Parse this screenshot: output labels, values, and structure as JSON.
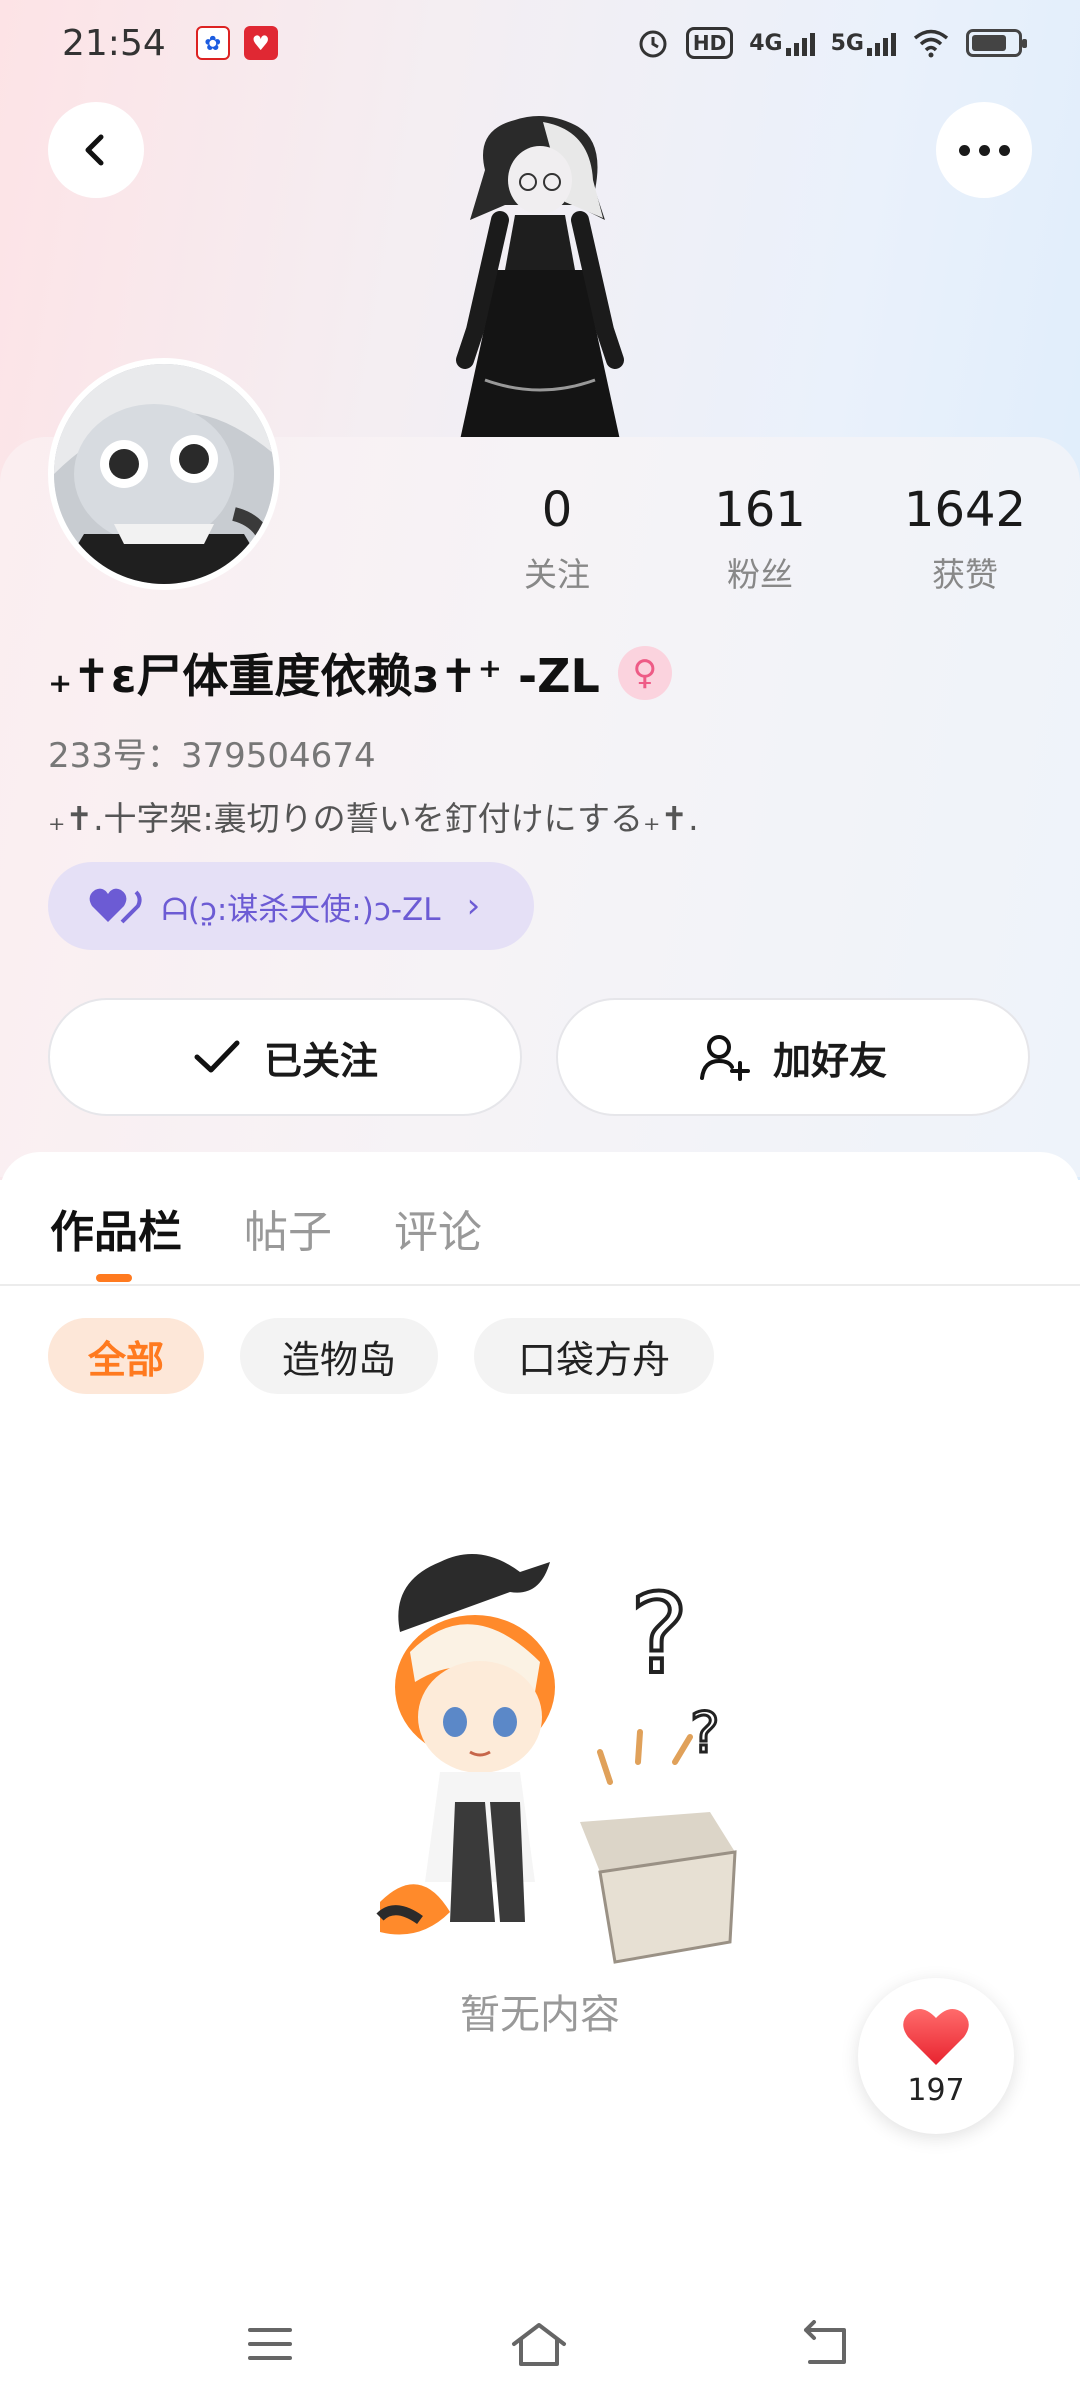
{
  "status_bar": {
    "time": "21:54",
    "hd_label": "HD",
    "net_4g": "4G",
    "net_5g": "5G",
    "icons": [
      "baidu-app-icon",
      "heart-app-icon",
      "alarm-icon",
      "hd-icon",
      "signal-4g-icon",
      "signal-5g-icon",
      "wifi-icon",
      "battery-icon"
    ]
  },
  "header": {
    "back_icon": "chevron-left-icon",
    "more_icon": "more-dots-icon"
  },
  "profile": {
    "nickname": "₊✝︎ɛ尸体重度依赖з✝︎⁺ -ZL",
    "gender_symbol": "♀",
    "uid": "233号：379504674",
    "bio": "₊✝︎.十字架:裏切りの誓いを釘付けにする₊✝︎.",
    "guild_name": "ᗩ(ɔ̤:谋杀天使:)ɔ-ZL",
    "guild_arrow": "›"
  },
  "stats": [
    {
      "value": "0",
      "label": "关注"
    },
    {
      "value": "161",
      "label": "粉丝"
    },
    {
      "value": "1642",
      "label": "获赞"
    }
  ],
  "actions": {
    "follow_label": "已关注",
    "add_friend_label": "加好友"
  },
  "tabs": [
    "作品栏",
    "帖子",
    "评论"
  ],
  "filters": [
    "全部",
    "造物岛",
    "口袋方舟"
  ],
  "empty_text": "暂无内容",
  "like_count": "197",
  "colors": {
    "accent": "#ff7a1f",
    "guild": "#6c5bd4",
    "like": "#f53d47"
  }
}
